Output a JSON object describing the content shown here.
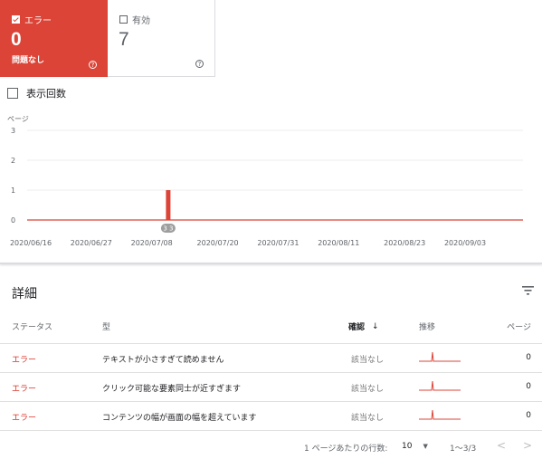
{
  "cards": {
    "error": {
      "label": "エラー",
      "count": "0",
      "subtitle": "問題なし"
    },
    "valid": {
      "label": "有効",
      "count": "7"
    }
  },
  "impressions_label": "表示回数",
  "chart_data": {
    "type": "bar",
    "ylabel": "ページ",
    "ylim": [
      0,
      3
    ],
    "yticks": [
      "3",
      "2",
      "1",
      "0"
    ],
    "xticks": [
      "2020/06/16",
      "2020/06/27",
      "2020/07/08",
      "2020/07/20",
      "2020/07/31",
      "2020/08/11",
      "2020/08/23",
      "2020/09/03"
    ],
    "series": [
      {
        "values": [
          {
            "x": "2020/07/11",
            "y": 1
          }
        ]
      }
    ],
    "marker_label": "3 3",
    "color": "#db4437"
  },
  "details": {
    "title": "詳細",
    "columns": {
      "status": "ステータス",
      "type": "型",
      "verify": "確認",
      "trend": "推移",
      "pages": "ページ"
    },
    "rows": [
      {
        "status": "エラー",
        "type": "テキストが小さすぎて読めません",
        "verify": "該当なし",
        "pages": "0"
      },
      {
        "status": "エラー",
        "type": "クリック可能な要素同士が近すぎます",
        "verify": "該当なし",
        "pages": "0"
      },
      {
        "status": "エラー",
        "type": "コンテンツの幅が画面の幅を超えています",
        "verify": "該当なし",
        "pages": "0"
      }
    ]
  },
  "pagination": {
    "rows_per_page_label": "1 ページあたりの行数:",
    "rows_per_page": "10",
    "range": "1～3/3"
  }
}
